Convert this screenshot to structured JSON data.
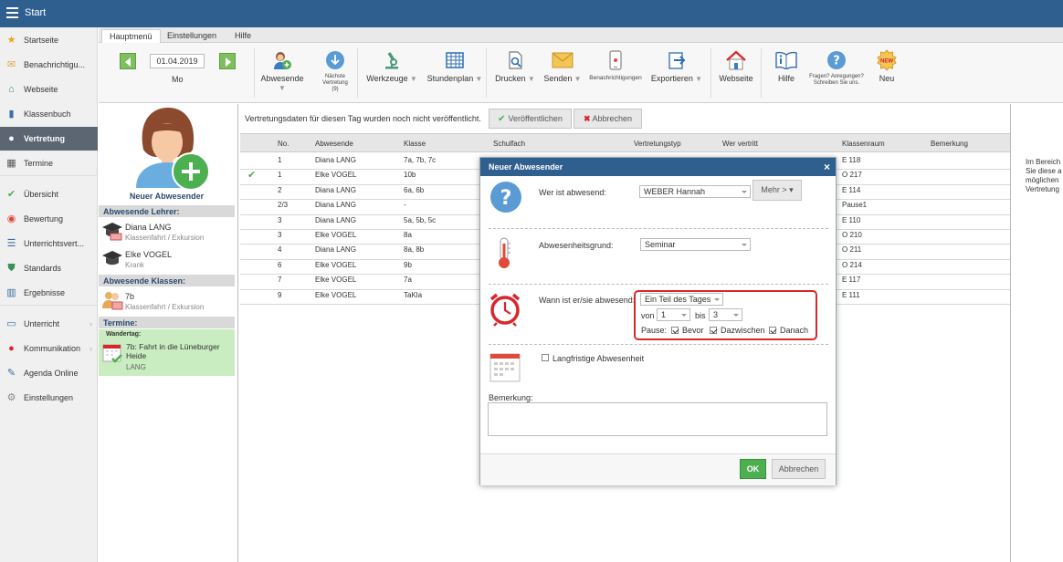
{
  "app": {
    "title": "Start"
  },
  "sidebar": {
    "items": [
      {
        "label": "Startseite",
        "icon": "star-icon",
        "color": "#e6a817"
      },
      {
        "label": "Benachrichtigu...",
        "icon": "mail-icon",
        "color": "#e8a33c"
      },
      {
        "label": "Webseite",
        "icon": "house-icon",
        "color": "#3a8f5a"
      },
      {
        "label": "Klassenbuch",
        "icon": "book-icon",
        "color": "#3b6ea5"
      },
      {
        "label": "Vertretung",
        "icon": "person-icon",
        "color": "#ffffff",
        "active": true
      },
      {
        "label": "Termine",
        "icon": "calendar-icon",
        "color": "#555555"
      },
      {
        "label": "Übersicht",
        "icon": "check-circle-icon",
        "color": "#4caf50"
      },
      {
        "label": "Bewertung",
        "icon": "gauge-icon",
        "color": "#e04a3a"
      },
      {
        "label": "Unterrichtsvert...",
        "icon": "list-icon",
        "color": "#3b6ea5"
      },
      {
        "label": "Standards",
        "icon": "shield-icon",
        "color": "#3a8f5a"
      },
      {
        "label": "Ergebnisse",
        "icon": "bar-chart-icon",
        "color": "#3b6ea5"
      },
      {
        "label": "Unterricht",
        "icon": "monitor-icon",
        "color": "#3b6ea5"
      },
      {
        "label": "Kommunikation",
        "icon": "chat-icon",
        "color": "#d9262b"
      },
      {
        "label": "Agenda Online",
        "icon": "pen-icon",
        "color": "#3b6ea5"
      },
      {
        "label": "Einstellungen",
        "icon": "gear-icon",
        "color": "#888888"
      }
    ]
  },
  "tabs": [
    "Hauptmenü",
    "Einstellungen",
    "Hilfe"
  ],
  "toolbar": {
    "date": "01.04.2019",
    "day": "Mo",
    "absent": "Abwesende",
    "next_sub": "Nächste Vertretung (9)",
    "tools": "Werkzeuge",
    "timetable": "Stundenplan",
    "print": "Drucken",
    "send": "Senden",
    "notifications": "Benachrichtigungen",
    "export": "Exportieren",
    "website": "Webseite",
    "help": "Hilfe",
    "questions": "Fragen? Anregungen? Schreiben Sie uns.",
    "new": "Neu",
    "new_badge": "NEW"
  },
  "left": {
    "new_absent": "Neuer Abwesender",
    "teachers_header": "Abwesende Lehrer:",
    "teachers": [
      {
        "name": "Diana LANG",
        "reason": "Klassenfahrt / Exkursion"
      },
      {
        "name": "Elke VOGEL",
        "reason": "Krank"
      }
    ],
    "classes_header": "Abwesende Klassen:",
    "classes": [
      {
        "name": "7b",
        "reason": "Klassenfahrt / Exkursion"
      }
    ],
    "events_header": "Termine:",
    "event_type": "Wandertag:",
    "event_title": "7b: Fahrt in die Lüneburger Heide",
    "event_person": "LANG"
  },
  "main": {
    "message": "Vertretungsdaten für diesen Tag wurden noch nicht veröffentlicht.",
    "publish": "Veröffentlichen",
    "cancel": "Abbrechen"
  },
  "table": {
    "columns": [
      "No.",
      "Abwesende",
      "Klasse",
      "Schulfach",
      "Vertretungstyp",
      "Wer vertritt",
      "Klassenraum",
      "Bemerkung"
    ],
    "rows": [
      {
        "no": "1",
        "absent": "Diana LANG",
        "cls": "7a, 7b, 7c",
        "room": "E 118",
        "check": false
      },
      {
        "no": "1",
        "absent": "Elke VOGEL",
        "cls": "10b",
        "room": "O 217",
        "check": true
      },
      {
        "no": "2",
        "absent": "Diana LANG",
        "cls": "6a, 6b",
        "room": "E 114",
        "check": false
      },
      {
        "no": "2/3",
        "absent": "Diana LANG",
        "cls": "-",
        "room": "Pause1",
        "check": false
      },
      {
        "no": "3",
        "absent": "Diana LANG",
        "cls": "5a, 5b, 5c",
        "room": "E 110",
        "check": false
      },
      {
        "no": "3",
        "absent": "Elke VOGEL",
        "cls": "8a",
        "room": "O 210",
        "check": false
      },
      {
        "no": "4",
        "absent": "Diana LANG",
        "cls": "8a, 8b",
        "room": "O 211",
        "check": false
      },
      {
        "no": "6",
        "absent": "Elke VOGEL",
        "cls": "9b",
        "room": "O 214",
        "check": false
      },
      {
        "no": "7",
        "absent": "Elke VOGEL",
        "cls": "7a",
        "room": "E 117",
        "check": false
      },
      {
        "no": "9",
        "absent": "Elke VOGEL",
        "cls": "TaKla",
        "room": "E 111",
        "check": false
      }
    ]
  },
  "right_panel": [
    "Im Bereich",
    "Sie diese a",
    "möglichen",
    "Vertretung"
  ],
  "dialog": {
    "title": "Neuer Abwesender",
    "who_label": "Wer ist abwesend:",
    "who_value": "WEBER Hannah",
    "more": "Mehr > ▾",
    "reason_label": "Abwesenheitsgrund:",
    "reason_value": "Seminar",
    "when_label": "Wann ist er/sie abwesend:",
    "when_value": "Ein Teil des Tages",
    "from_label": "von",
    "from_value": "1",
    "to_label": "bis",
    "to_value": "3",
    "pause_label": "Pause:",
    "pause_before": "Bevor",
    "pause_between": "Dazwischen",
    "pause_after": "Danach",
    "longterm": "Langfristige Abwesenheit",
    "remark_label": "Bemerkung:",
    "ok": "OK",
    "cancel": "Abbrechen"
  }
}
